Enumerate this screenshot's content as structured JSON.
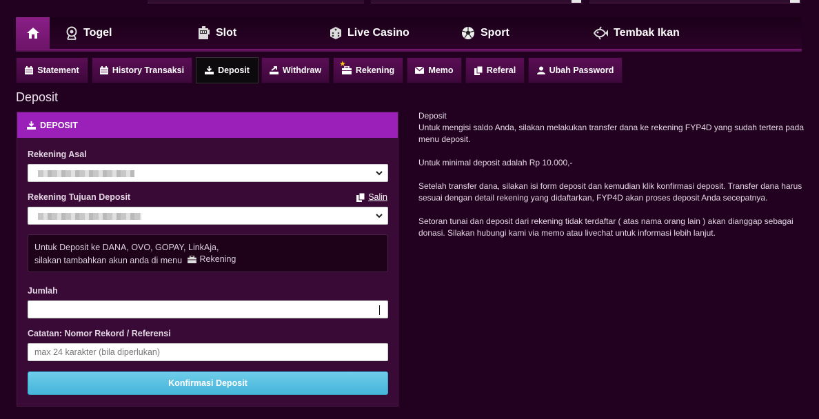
{
  "nav": {
    "home_icon": "home-icon",
    "items": [
      {
        "label": "Togel",
        "icon": "lottery-ball-icon"
      },
      {
        "label": "Slot",
        "icon": "slot-machine-icon"
      },
      {
        "label": "Live Casino",
        "icon": "dice-icon"
      },
      {
        "label": "Sport",
        "icon": "soccer-ball-icon"
      },
      {
        "label": "Tembak Ikan",
        "icon": "fish-icon"
      }
    ]
  },
  "tabs": [
    {
      "label": "Statement",
      "icon": "calendar-icon"
    },
    {
      "label": "History Transaksi",
      "icon": "calendar-icon"
    },
    {
      "label": "Deposit",
      "icon": "deposit-icon",
      "active": true
    },
    {
      "label": "Withdraw",
      "icon": "withdraw-icon"
    },
    {
      "label": "Rekening",
      "icon": "bank-icon",
      "badge": "★"
    },
    {
      "label": "Memo",
      "icon": "envelope-icon"
    },
    {
      "label": "Referal",
      "icon": "copy-icon"
    },
    {
      "label": "Ubah Password",
      "icon": "user-icon"
    }
  ],
  "page_title": "Deposit",
  "form": {
    "header": "DEPOSIT",
    "rekening_asal_label": "Rekening Asal",
    "rekening_tujuan_label": "Rekening Tujuan Deposit",
    "salin_label": "Salin",
    "note_line1": "Untuk Deposit ke DANA, OVO, GOPAY, LinkAja,",
    "note_line2": "silakan tambahkan akun anda di menu",
    "note_link": "Rekening",
    "jumlah_label": "Jumlah",
    "jumlah_value": "",
    "catatan_label": "Catatan: Nomor Rekord / Referensi",
    "catatan_placeholder": "max 24 karakter (bila diperlukan)",
    "confirm_label": "Konfirmasi Deposit"
  },
  "info": {
    "title": "Deposit",
    "p1": "Untuk mengisi saldo Anda, silakan melakukan transfer dana ke rekening FYP4D yang sudah tertera pada menu deposit.",
    "p2": "Untuk minimal deposit adalah Rp 10.000,-",
    "p3": "Setelah transfer dana, silakan isi form deposit dan kemudian klik konfirmasi deposit. Transfer dana harus sesuai dengan detail rekening yang didaftarkan, FYP4D akan proses deposit Anda secepatnya.",
    "p4": "Setoran tunai dan deposit dari rekening tidak terdaftar ( atas nama orang lain ) akan dianggap sebagai donasi. Silakan hubungi kami via memo atau livechat untuk informasi lebih lanjut."
  }
}
